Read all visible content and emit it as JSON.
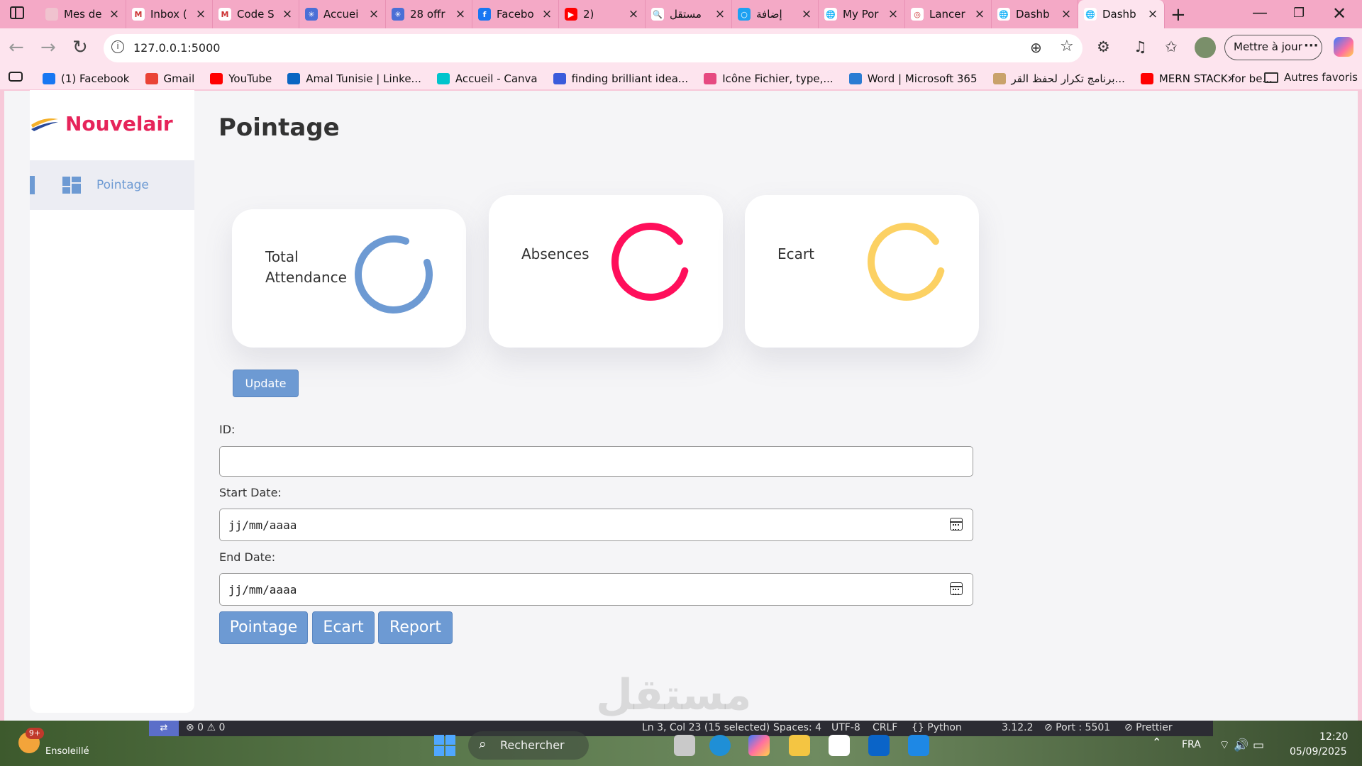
{
  "browser": {
    "tabs": [
      {
        "label": "Mes de",
        "fav": "#f0c3cf",
        "glyph": ""
      },
      {
        "label": "Inbox (",
        "fav": "#ffffff",
        "glyph": "M"
      },
      {
        "label": "Code S",
        "fav": "#ffffff",
        "glyph": "M"
      },
      {
        "label": "Accuei",
        "fav": "#4a6fd6",
        "glyph": "✳"
      },
      {
        "label": "28 offr",
        "fav": "#4a6fd6",
        "glyph": "✳"
      },
      {
        "label": "Facebo",
        "fav": "#1877f2",
        "glyph": "f"
      },
      {
        "label": "2)",
        "fav": "#ff0000",
        "glyph": "▶"
      },
      {
        "label": "مستقل",
        "fav": "#ffffff",
        "glyph": "🔍"
      },
      {
        "label": "إضافة",
        "fav": "#1da1f2",
        "glyph": "○"
      },
      {
        "label": "My Por",
        "fav": "#ffffff",
        "glyph": "🌐"
      },
      {
        "label": "Lancer",
        "fav": "#ffffff",
        "glyph": "◎"
      },
      {
        "label": "Dashb",
        "fav": "#ffffff",
        "glyph": "🌐"
      },
      {
        "label": "Dashb",
        "fav": "#ffffff",
        "glyph": "🌐",
        "active": true
      }
    ],
    "url": "127.0.0.1:5000",
    "update_label": "Mettre à jour",
    "bookmarks": [
      {
        "label": "(1) Facebook",
        "color": "#1877f2"
      },
      {
        "label": "Gmail",
        "color": "#ea4335"
      },
      {
        "label": "YouTube",
        "color": "#ff0000"
      },
      {
        "label": "Amal Tunisie | Linke...",
        "color": "#0a66c2"
      },
      {
        "label": "Accueil - Canva",
        "color": "#00c4cc"
      },
      {
        "label": "finding brilliant idea...",
        "color": "#3b5bdb"
      },
      {
        "label": "Icône Fichier, type,...",
        "color": "#e64980"
      },
      {
        "label": "Word | Microsoft 365",
        "color": "#2b7cd3"
      },
      {
        "label": "برنامج تكرار لحفظ القر...",
        "color": "#c9a26b"
      },
      {
        "label": "MERN STACK for be...",
        "color": "#ff0000"
      }
    ],
    "other_bookmarks": "Autres favoris"
  },
  "app": {
    "brand": "Nouvelair",
    "sidebar_item": "Pointage",
    "page_title": "Pointage",
    "cards": {
      "attendance": {
        "label": "Total Attendance",
        "color": "#6d9ad3"
      },
      "absences": {
        "label": "Absences",
        "color": "#ff0f5b"
      },
      "ecart": {
        "label": "Ecart",
        "color": "#fcd163"
      }
    },
    "update_button": "Update",
    "form": {
      "id_label": "ID:",
      "start_label": "Start Date:",
      "end_label": "End Date:",
      "date_placeholder": "jj/mm/aaaa"
    },
    "actions": {
      "pointage": "Pointage",
      "ecart": "Ecart",
      "report": "Report"
    }
  },
  "watermark": "مستقل",
  "vscode_status": {
    "problems": "⊗ 0 ⚠ 0",
    "cursor": "Ln 3, Col 23 (15 selected)",
    "spaces": "Spaces: 4",
    "encoding": "UTF-8",
    "eol": "CRLF",
    "language": "{} Python",
    "version": "3.12.2",
    "port": "⊘ Port : 5501",
    "prettier": "⊘ Prettier"
  },
  "taskbar": {
    "weather_badge": "9+",
    "weather": "Ensoleillé",
    "search": "Rechercher",
    "lang": "FRA",
    "time": "12:20",
    "date": "05/09/2025"
  }
}
